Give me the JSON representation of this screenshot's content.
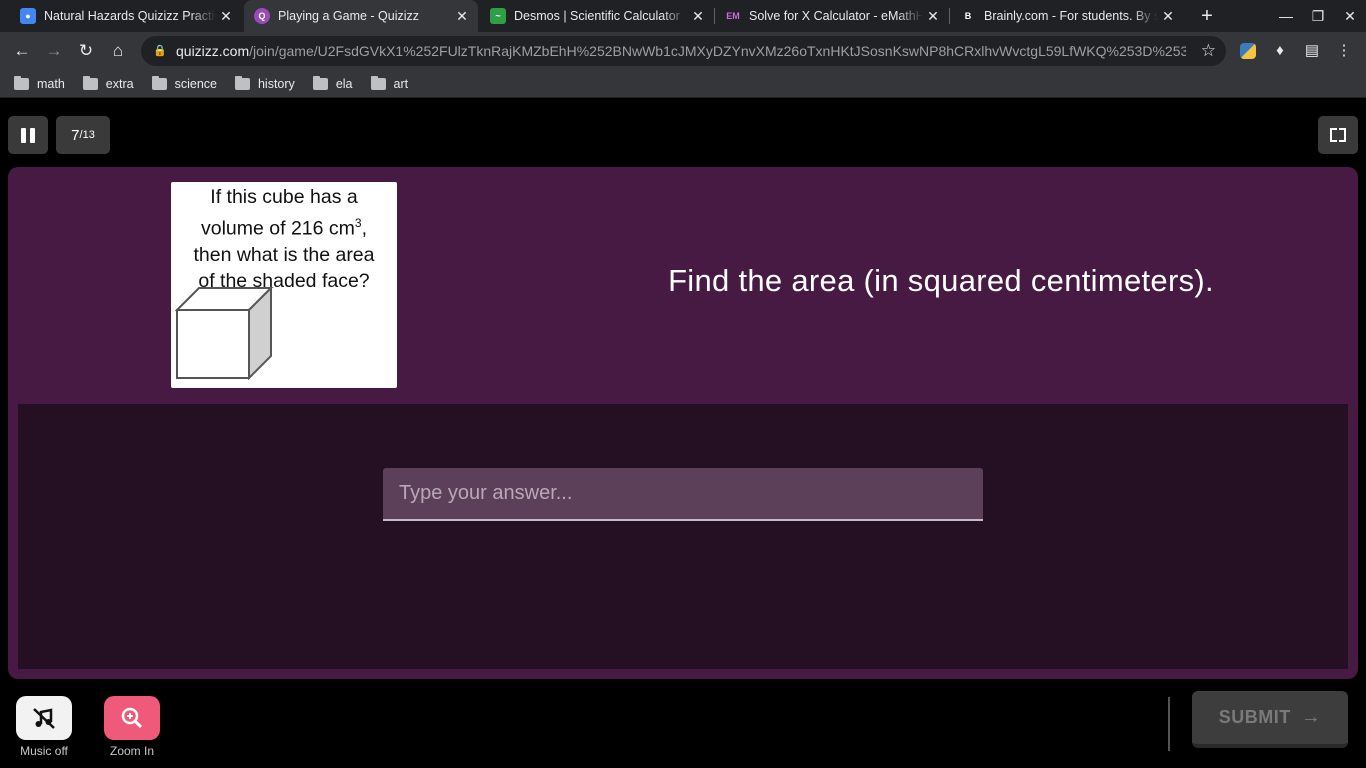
{
  "browser": {
    "tabs": [
      {
        "title": "Natural Hazards Quizizz Practice",
        "favicon_color": "#4285f4",
        "active": false
      },
      {
        "title": "Playing a Game - Quizizz",
        "favicon_color": "#9c4ab8",
        "active": true
      },
      {
        "title": "Desmos | Scientific Calculator",
        "favicon_color": "#2f9e44",
        "active": false
      },
      {
        "title": "Solve for X Calculator - eMathHelp",
        "favicon_color": "#7a3b8f",
        "active": false
      },
      {
        "title": "Brainly.com - For students. By students.",
        "favicon_color": "#202124",
        "active": false
      }
    ],
    "url_host": "quizizz.com",
    "url_path": "/join/game/U2FsdGVkX1%252FUlzTknRajKMZbEhH%252BNwWb1cJMXyDZYnvXMz26oTxnHKtJSosnKswNP8hCRxlhvWvctgL59LfWKQ%253D%253...",
    "bookmarks": [
      "math",
      "extra",
      "science",
      "history",
      "ela",
      "art"
    ]
  },
  "quiz": {
    "progress_current": "7",
    "progress_total": "/13",
    "image_text_line1": "If this cube has a",
    "image_text_line2": "volume of 216 cm",
    "image_text_sup": "3",
    "image_text_line2_end": ",",
    "image_text_line3": "then what is the area",
    "image_text_line4": "of the shaded face?",
    "question": "Find the area (in squared centimeters).",
    "answer_placeholder": "Type your answer...",
    "submit_label": "SUBMIT",
    "music_label": "Music off",
    "zoom_label": "Zoom In",
    "colors": {
      "card_bg": "#461a42",
      "answer_bg": "#250f23",
      "zoom_button": "#ef5a7a"
    }
  }
}
